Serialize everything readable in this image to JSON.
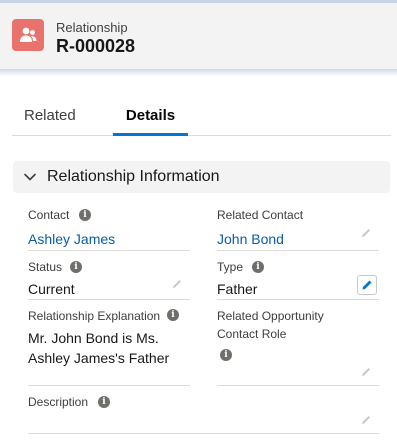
{
  "header": {
    "object_label": "Relationship",
    "record_name": "R-000028",
    "icon": "relationship-icon"
  },
  "tabs": [
    {
      "label": "Related",
      "active": false
    },
    {
      "label": "Details",
      "active": true
    }
  ],
  "section": {
    "title": "Relationship Information",
    "icon": "chevron-down-icon"
  },
  "fields": {
    "contact": {
      "label": "Contact",
      "value": "Ashley James"
    },
    "related_contact": {
      "label": "Related Contact",
      "value": "John Bond"
    },
    "status": {
      "label": "Status",
      "value": "Current"
    },
    "type": {
      "label": "Type",
      "value": "Father"
    },
    "relationship_explanation": {
      "label": "Relationship Explanation",
      "value_line1": "Mr. John Bond is Ms.",
      "value_line2": "Ashley James's Father"
    },
    "related_opportunity_contact_role": {
      "label_line1": "Related Opportunity",
      "label_line2": "Contact Role",
      "value": ""
    },
    "description": {
      "label": "Description",
      "value": ""
    }
  },
  "colors": {
    "brand_blue": "#0176d3",
    "link": "#0b5cab",
    "record_icon_bg": "#e8736c"
  }
}
